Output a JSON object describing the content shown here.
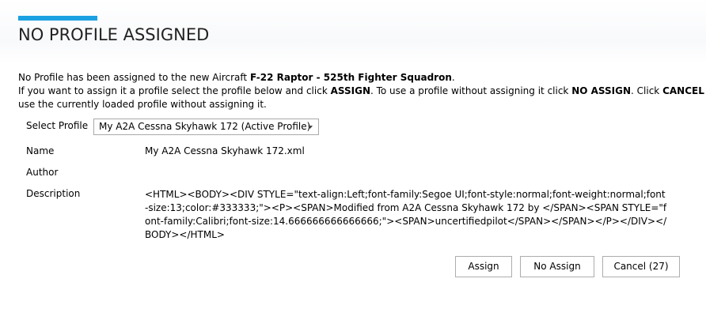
{
  "dialog": {
    "title": "NO PROFILE ASSIGNED"
  },
  "message": {
    "line1_prefix": "No Profile has been assigned to the new Aircraft ",
    "aircraft": "F-22 Raptor - 525th Fighter Squadron",
    "line1_suffix": ".",
    "line2_part1": "If you want to assign it a profile select the profile below and click ",
    "assign_word": "ASSIGN",
    "line2_part2": ". To use a profile without assigning it click ",
    "no_assign_word": "NO ASSIGN",
    "line2_part3": ". Click ",
    "cancel_word": "CANCEL",
    "line2_part4": " to",
    "line3": "use the currently loaded profile without assigning it."
  },
  "form": {
    "select_profile_label": "Select Profile",
    "selected_profile": "My A2A Cessna Skyhawk 172 (Active Profile)",
    "name_label": "Name",
    "name_value": "My A2A Cessna Skyhawk 172.xml",
    "author_label": "Author",
    "author_value": "",
    "description_label": "Description",
    "description_value": "<HTML><BODY><DIV STYLE=\"text-align:Left;font-family:Segoe UI;font-style:normal;font-weight:normal;font-size:13;color:#333333;\"><P><SPAN>Modified from A2A Cessna Skyhawk 172 by </SPAN><SPAN STYLE=\"font-family:Calibri;font-size:14.666666666666666;\"><SPAN>uncertifiedpilot</SPAN></SPAN></P></DIV></BODY></HTML>"
  },
  "buttons": {
    "assign": "Assign",
    "no_assign": "No Assign",
    "cancel": "Cancel (27)"
  },
  "colors": {
    "accent": "#1ba1e2",
    "title_text": "#222222",
    "button_border": "#adadad"
  },
  "icons": {
    "select_arrow": "chevron-down-icon"
  }
}
